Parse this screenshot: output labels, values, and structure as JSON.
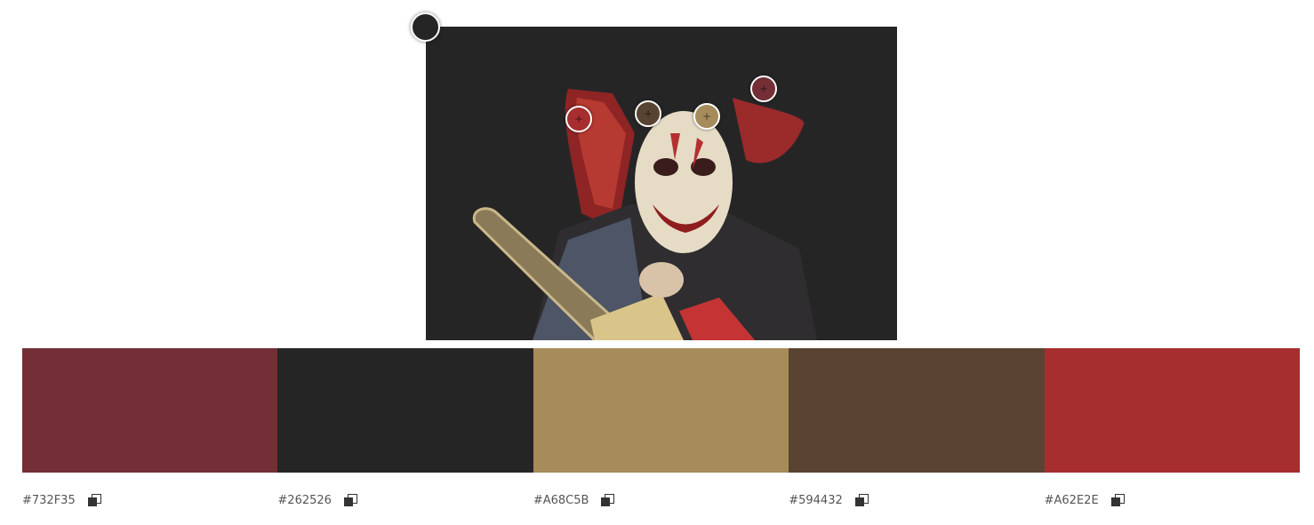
{
  "image": {
    "description_icon": "photo-icon",
    "background": "#262526"
  },
  "pickers": [
    {
      "name": "picker-red",
      "color": "#A62E2E"
    },
    {
      "name": "picker-brown",
      "color": "#594432"
    },
    {
      "name": "picker-tan",
      "color": "#A68C5B"
    },
    {
      "name": "picker-maroon",
      "color": "#732F35"
    }
  ],
  "corner_handle": {
    "color": "#262526"
  },
  "palette": [
    {
      "hex": "#732F35",
      "color": "#732F35"
    },
    {
      "hex": "#262526",
      "color": "#262526"
    },
    {
      "hex": "#A68C5B",
      "color": "#A68C5B"
    },
    {
      "hex": "#594432",
      "color": "#594432"
    },
    {
      "hex": "#A62E2E",
      "color": "#A62E2E"
    }
  ]
}
